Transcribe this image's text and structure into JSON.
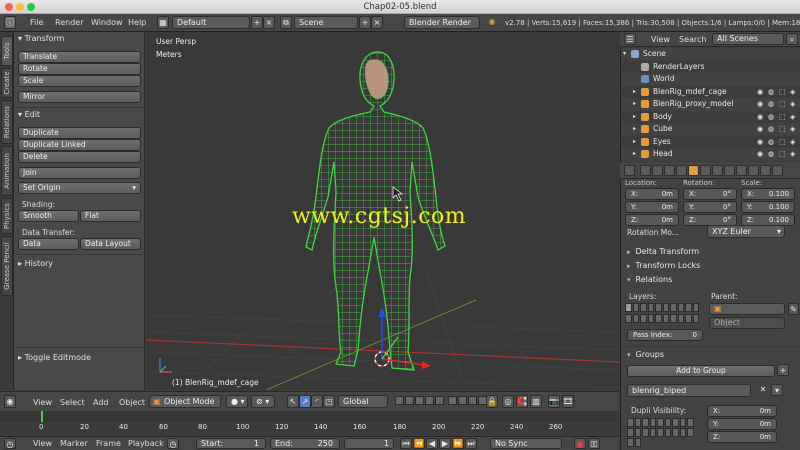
{
  "window": {
    "title": "Chap02-05.blend"
  },
  "infobar": {
    "menus": [
      "File",
      "Render",
      "Window",
      "Help"
    ],
    "layout": "Default",
    "scene": "Scene",
    "engine": "Blender Render",
    "stats": "v2.78 | Verts:15,619 | Faces:15,386 | Tris:30,508 | Objects:1/6 | Lamps:0/0 | Mem:184."
  },
  "left_tabs": [
    "Tools",
    "Create",
    "Relations",
    "Animation",
    "Physics",
    "Grease Pencil"
  ],
  "tools": {
    "transform_header": "Transform",
    "translate": "Translate",
    "rotate": "Rotate",
    "scale": "Scale",
    "mirror": "Mirror",
    "edit_header": "Edit",
    "duplicate": "Duplicate",
    "duplicate_linked": "Duplicate Linked",
    "delete": "Delete",
    "join": "Join",
    "set_origin": "Set Origin",
    "shading_label": "Shading:",
    "smooth": "Smooth",
    "flat": "Flat",
    "data_transfer_label": "Data Transfer:",
    "data": "Data",
    "data_layout": "Data Layout",
    "history_header": "History",
    "toggle_editmode": "Toggle Editmode"
  },
  "viewport": {
    "view_name": "User Persp",
    "units": "Meters",
    "active_object": "(1) BlenRig_mdef_cage",
    "watermark": "www.cgtsj.com"
  },
  "viewport_header": {
    "menus": [
      "View",
      "Select",
      "Add",
      "Object"
    ],
    "mode": "Object Mode",
    "orientation": "Global"
  },
  "timeline": {
    "ticks": [
      "0",
      "20",
      "40",
      "60",
      "80",
      "100",
      "120",
      "140",
      "160",
      "180",
      "200",
      "220",
      "240",
      "260"
    ],
    "menus": [
      "View",
      "Marker",
      "Frame",
      "Playback"
    ],
    "start_label": "Start:",
    "start_value": "1",
    "end_label": "End:",
    "end_value": "250",
    "current_frame": "1",
    "sync": "No Sync"
  },
  "outliner": {
    "menus": [
      "View",
      "Search"
    ],
    "filter": "All Scenes",
    "rows": [
      {
        "name": "Scene",
        "indent": 0,
        "color": "#8aa5c8"
      },
      {
        "name": "RenderLayers",
        "indent": 1,
        "color": "#aaaaaa"
      },
      {
        "name": "World",
        "indent": 1,
        "color": "#6d8fbd"
      },
      {
        "name": "BlenRig_mdef_cage",
        "indent": 1,
        "color": "#e59b3a"
      },
      {
        "name": "BlenRig_proxy_model",
        "indent": 1,
        "color": "#e59b3a"
      },
      {
        "name": "Body",
        "indent": 1,
        "color": "#e59b3a"
      },
      {
        "name": "Cube",
        "indent": 1,
        "color": "#e59b3a"
      },
      {
        "name": "Eyes",
        "indent": 1,
        "color": "#e59b3a"
      },
      {
        "name": "Head",
        "indent": 1,
        "color": "#e59b3a"
      }
    ]
  },
  "properties": {
    "col_labels": [
      "Location:",
      "Rotation:",
      "Scale:"
    ],
    "location": [
      {
        "k": "X:",
        "v": "0m"
      },
      {
        "k": "Y:",
        "v": "0m"
      },
      {
        "k": "Z:",
        "v": "0m"
      }
    ],
    "rotation": [
      {
        "k": "X:",
        "v": "0°"
      },
      {
        "k": "Y:",
        "v": "0°"
      },
      {
        "k": "Z:",
        "v": "0°"
      }
    ],
    "scale": [
      {
        "k": "X:",
        "v": "0.100"
      },
      {
        "k": "Y:",
        "v": "0.100"
      },
      {
        "k": "Z:",
        "v": "0.100"
      }
    ],
    "rotation_mode_label": "Rotation Mo...",
    "rotation_mode": "XYZ Euler",
    "delta_transform": "Delta Transform",
    "transform_locks": "Transform Locks",
    "relations": "Relations",
    "layers_label": "Layers:",
    "parent_label": "Parent:",
    "parent_type": "Object",
    "pass_index_label": "Pass Index:",
    "pass_index": "0",
    "groups": "Groups",
    "add_to_group": "Add to Group",
    "group_name": "blenrig_biped",
    "dupli_visibility": "Dupli Visibility:",
    "dupli_x": "X:",
    "dupli_x_val": "0m",
    "dupli_y": "Y:",
    "dupli_y_val": "0m",
    "dupli_z": "Z:",
    "dupli_z_val": "0m"
  },
  "colors": {
    "wire": "#3fd63f",
    "accent": "#5680c2",
    "watermark": "#f0f020"
  }
}
